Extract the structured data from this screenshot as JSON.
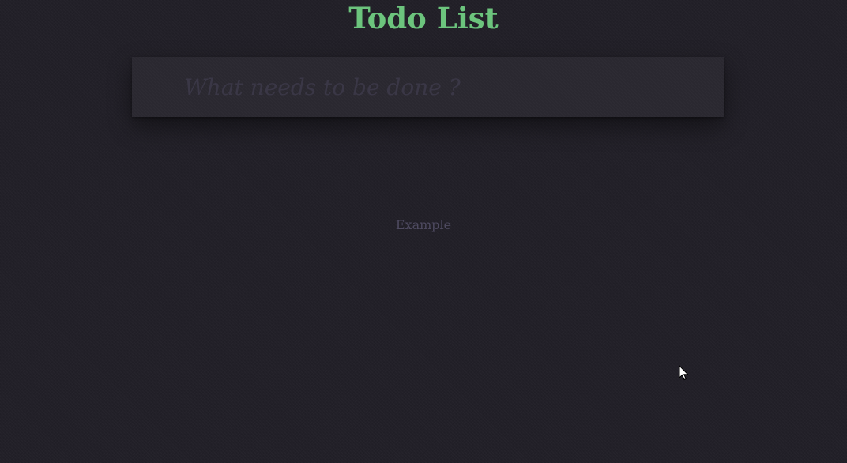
{
  "header": {
    "title": "Todo List"
  },
  "new_todo": {
    "value": "",
    "placeholder": "What needs to be done ?"
  },
  "footer": {
    "link_label": "Example"
  },
  "colors": {
    "background": "#222028",
    "title": "#6cc47d",
    "input_background": "#2a2830",
    "placeholder": "#3a3746",
    "footer_text": "#4e4a60"
  },
  "icons": {
    "cursor": "mouse-pointer-icon"
  }
}
